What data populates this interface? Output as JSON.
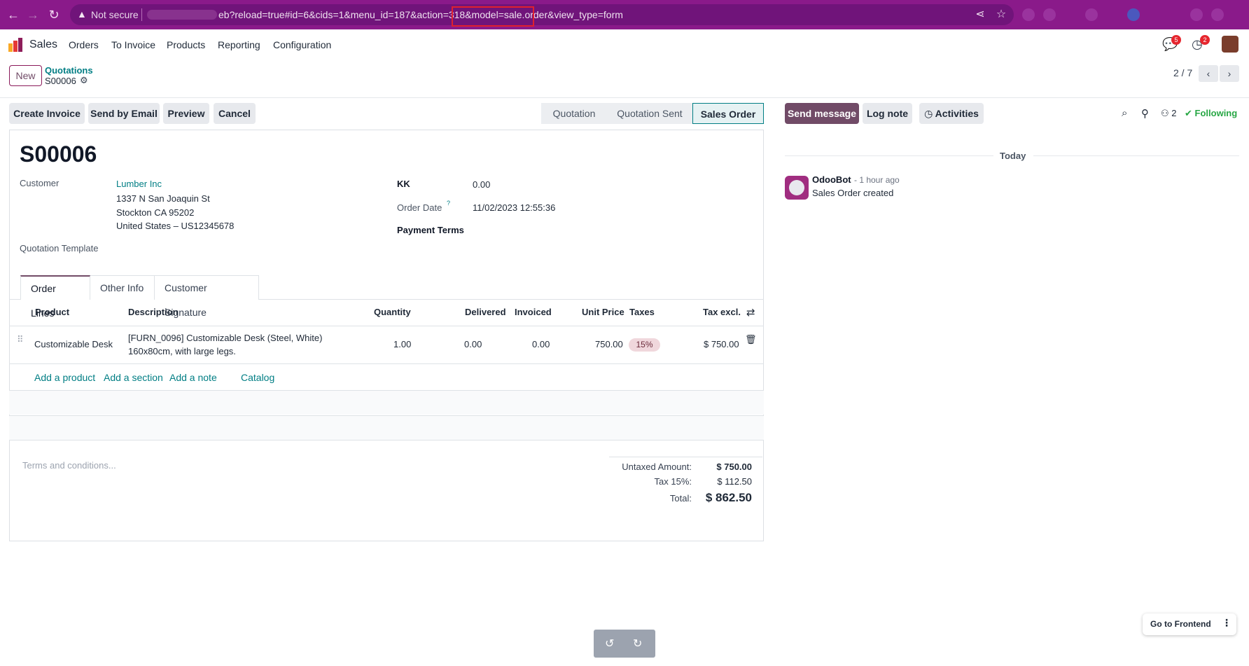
{
  "browser": {
    "security_text": "Not secure",
    "url": "eb?reload=true#id=6&cids=1&menu_id=187&action=318&model=sale.order&view_type=form"
  },
  "app": {
    "name": "Sales",
    "menu": [
      "Orders",
      "To Invoice",
      "Products",
      "Reporting",
      "Configuration"
    ],
    "messages_count": "5",
    "activities_count": "2"
  },
  "control": {
    "new_label": "New",
    "breadcrumb_parent": "Quotations",
    "breadcrumb_current": "S00006",
    "pager": "2 / 7"
  },
  "actions": {
    "create_invoice": "Create Invoice",
    "send_by_email": "Send by Email",
    "preview": "Preview",
    "cancel": "Cancel"
  },
  "statusbar": {
    "stages": [
      "Quotation",
      "Quotation Sent",
      "Sales Order"
    ],
    "active": "Sales Order"
  },
  "form": {
    "title": "S00006",
    "customer_label": "Customer",
    "customer_name": "Lumber Inc",
    "address_line1": "1337 N San Joaquin St",
    "address_line2": "Stockton CA 95202",
    "address_line3": "United States – US12345678",
    "template_label": "Quotation Template",
    "kk_label": "KK",
    "kk_value": "0.00",
    "order_date_label": "Order Date",
    "order_date_help": "?",
    "order_date_value": "11/02/2023 12:55:36",
    "payment_terms_label": "Payment Terms"
  },
  "tabs": [
    "Order Lines",
    "Other Info",
    "Customer Signature"
  ],
  "lines": {
    "columns": [
      "Product",
      "Description",
      "Quantity",
      "Delivered",
      "Invoiced",
      "Unit Price",
      "Taxes",
      "Tax excl."
    ],
    "rows": [
      {
        "product": "Customizable Desk",
        "description_1": "[FURN_0096] Customizable Desk (Steel, White)",
        "description_2": "160x80cm, with large legs.",
        "quantity": "1.00",
        "delivered": "0.00",
        "invoiced": "0.00",
        "unit_price": "750.00",
        "taxes": "15%",
        "subtotal": "$ 750.00"
      }
    ],
    "add_product": "Add a product",
    "add_section": "Add a section",
    "add_note": "Add a note",
    "catalog": "Catalog"
  },
  "terms_placeholder": "Terms and conditions...",
  "totals": {
    "untaxed_label": "Untaxed Amount:",
    "untaxed_value": "$ 750.00",
    "tax_label": "Tax 15%:",
    "tax_value": "$ 112.50",
    "total_label": "Total:",
    "total_value": "$ 862.50"
  },
  "chatter": {
    "send_message": "Send message",
    "log_note": "Log note",
    "activities": "Activities",
    "followers_count": "2",
    "following": "Following",
    "date_separator": "Today",
    "author": "OdooBot",
    "time": "- 1 hour ago",
    "body": "Sales Order created"
  },
  "footer": {
    "go_frontend": "Go to Frontend"
  },
  "colors": {
    "browser_bar": "#8a1a8a",
    "primary": "#714b67",
    "link": "#017e84",
    "following": "#28a745"
  }
}
